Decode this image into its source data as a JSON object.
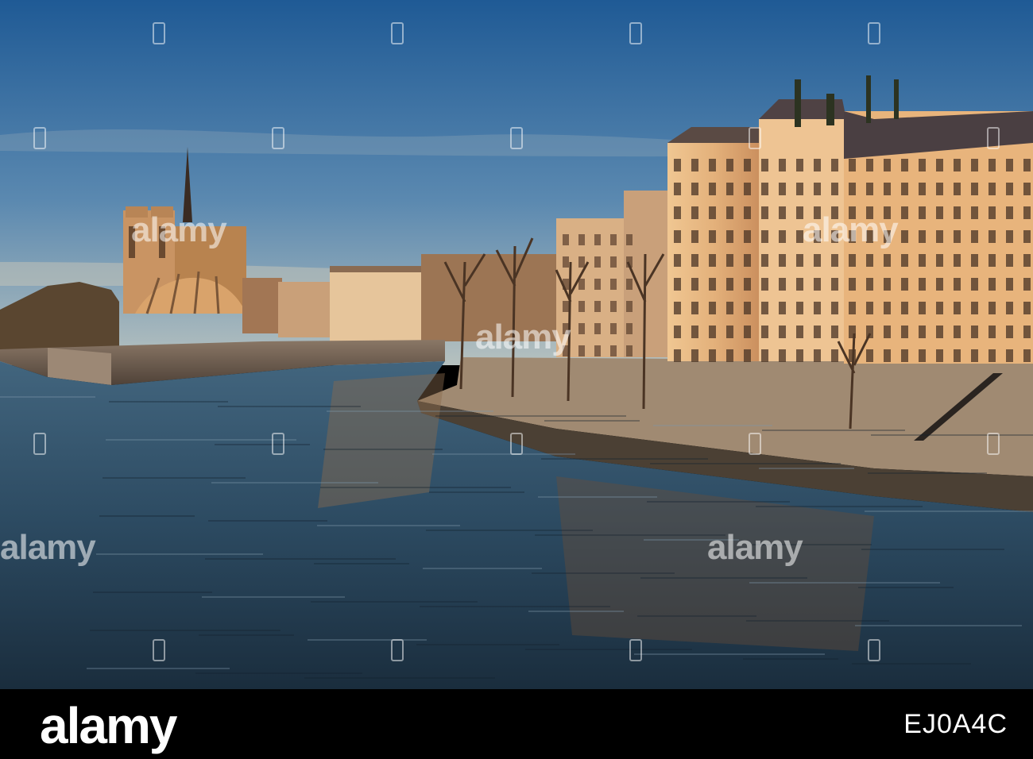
{
  "photo": {
    "scene": "photograph",
    "watermark_text": "alamy",
    "colors": {
      "sky_top": "#25609b",
      "sky_bottom": "#a9b9bd",
      "water_dark": "#1c3244",
      "water_light": "#3f6582",
      "facade_lit": "#e8b77f",
      "facade_shadow": "#8a6a52",
      "embankment": "#6b5a4c"
    }
  },
  "footer": {
    "logo": "alamy",
    "stock_id": "EJ0A4C"
  }
}
